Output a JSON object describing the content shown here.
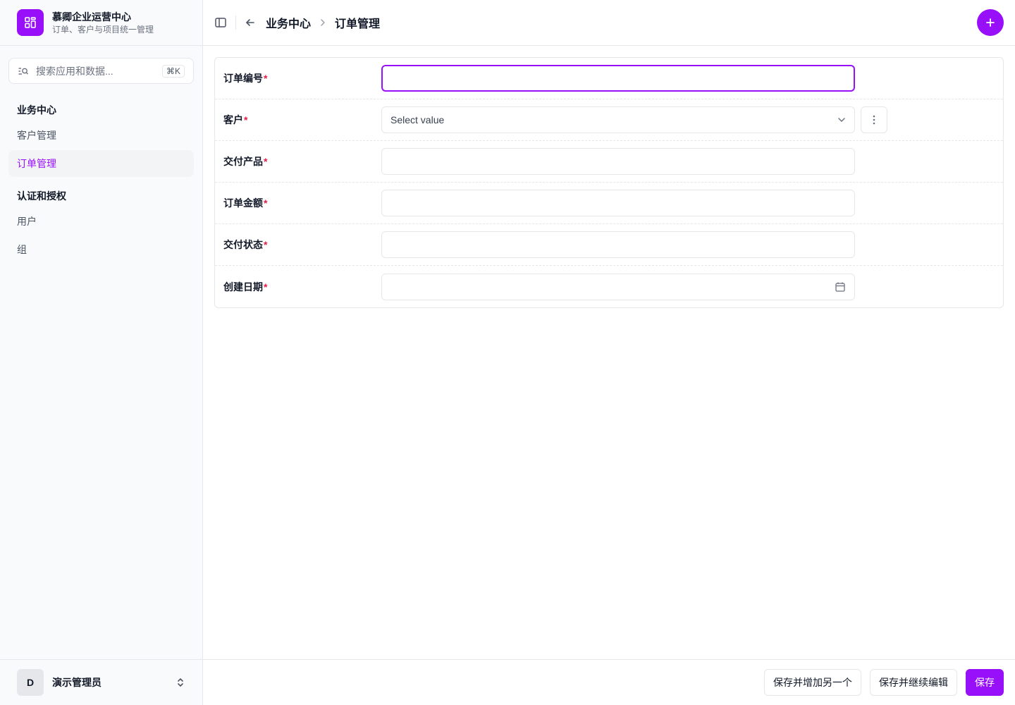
{
  "brand": {
    "name": "慕卿企业运营中心",
    "subtitle": "订单、客户与项目统一管理",
    "logo_icon": "grid-icon",
    "accent_color": "#9810fa"
  },
  "search": {
    "placeholder": "搜索应用和数据...",
    "shortcut": "⌘K"
  },
  "sidebar": {
    "groups": [
      {
        "title": "业务中心",
        "items": [
          {
            "label": "客户管理",
            "active": false
          },
          {
            "label": "订单管理",
            "active": true
          }
        ]
      },
      {
        "title": "认证和授权",
        "items": [
          {
            "label": "用户",
            "active": false
          },
          {
            "label": "组",
            "active": false
          }
        ]
      }
    ]
  },
  "user": {
    "initial": "D",
    "name": "演示管理员"
  },
  "header": {
    "breadcrumb": [
      "业务中心",
      "订单管理"
    ]
  },
  "form": {
    "required_mark": "*",
    "fields": [
      {
        "label": "订单编号",
        "type": "text",
        "value": "",
        "focused": true
      },
      {
        "label": "客户",
        "type": "select",
        "value": "Select value"
      },
      {
        "label": "交付产品",
        "type": "text",
        "value": ""
      },
      {
        "label": "订单金额",
        "type": "text",
        "value": ""
      },
      {
        "label": "交付状态",
        "type": "text",
        "value": ""
      },
      {
        "label": "创建日期",
        "type": "date",
        "value": ""
      }
    ]
  },
  "footer": {
    "save_add_another": "保存并增加另一个",
    "save_continue": "保存并继续编辑",
    "save": "保存"
  }
}
